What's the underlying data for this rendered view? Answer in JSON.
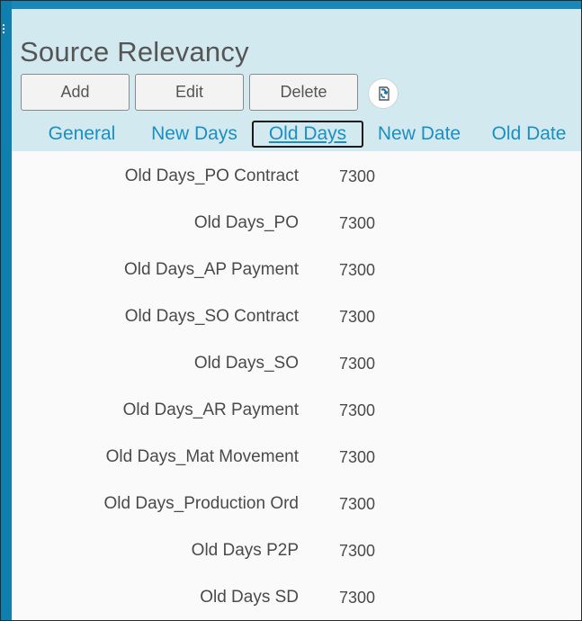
{
  "page": {
    "title": "Source Relevancy"
  },
  "toolbar": {
    "add_label": "Add",
    "edit_label": "Edit",
    "delete_label": "Delete",
    "refresh_icon": "refresh-icon"
  },
  "tabs": [
    {
      "label": "General",
      "active": false
    },
    {
      "label": "New Days",
      "active": false
    },
    {
      "label": "Old Days",
      "active": true
    },
    {
      "label": "New Date",
      "active": false
    },
    {
      "label": "Old Date",
      "active": false
    }
  ],
  "fields": [
    {
      "label": "Old Days_PO Contract",
      "value": "7300"
    },
    {
      "label": "Old Days_PO",
      "value": "7300"
    },
    {
      "label": "Old Days_AP Payment",
      "value": "7300"
    },
    {
      "label": "Old Days_SO Contract",
      "value": "7300"
    },
    {
      "label": "Old Days_SO",
      "value": "7300"
    },
    {
      "label": "Old Days_AR Payment",
      "value": "7300"
    },
    {
      "label": "Old Days_Mat Movement",
      "value": "7300"
    },
    {
      "label": "Old Days_Production Ord",
      "value": "7300"
    },
    {
      "label": "Old Days P2P",
      "value": "7300"
    },
    {
      "label": "Old Days SD",
      "value": "7300"
    }
  ],
  "colors": {
    "header_bg": "#d2e9f0",
    "tab_link": "#1a8fc4",
    "frame_blue": "#1b86b8"
  }
}
